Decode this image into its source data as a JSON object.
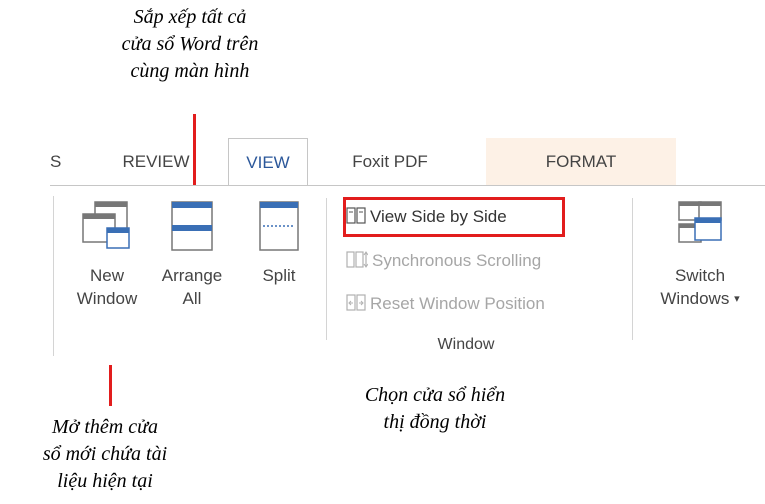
{
  "annotations": {
    "arrange_all": "Sắp xếp tất cả\ncửa sổ Word trên\ncùng màn hình",
    "view_side_by_side": "Chọn cửa sổ hiển\nthị đồng thời",
    "new_window": "Mở thêm cửa\nsổ mới chứa tài\nliệu hiện tại"
  },
  "tabs": {
    "partial": "S",
    "review": "REVIEW",
    "view": "VIEW",
    "foxit": "Foxit PDF",
    "format": "FORMAT"
  },
  "ribbon": {
    "new_window": [
      "New",
      "Window"
    ],
    "arrange_all": [
      "Arrange",
      "All"
    ],
    "split": "Split",
    "view_side_by_side": "View Side by Side",
    "synchronous_scrolling": "Synchronous Scrolling",
    "reset_window_position": "Reset Window Position",
    "switch_windows": [
      "Switch",
      "Windows"
    ],
    "group_label": "Window"
  },
  "colors": {
    "highlight": "#e21d1d",
    "active_tab": "#2b579a",
    "icon_blue": "#3a6fb5",
    "format_tab_bg": "#fdf1e6",
    "disabled_text": "#a6a6a6"
  },
  "icons": {
    "new_window": "new-window-icon",
    "arrange_all": "arrange-all-icon",
    "split": "split-icon",
    "view_side_by_side": "view-side-by-side-icon",
    "synchronous_scrolling": "sync-scroll-icon",
    "reset_window_position": "reset-position-icon",
    "switch_windows": "switch-windows-icon",
    "dropdown": "dropdown-caret-icon"
  }
}
